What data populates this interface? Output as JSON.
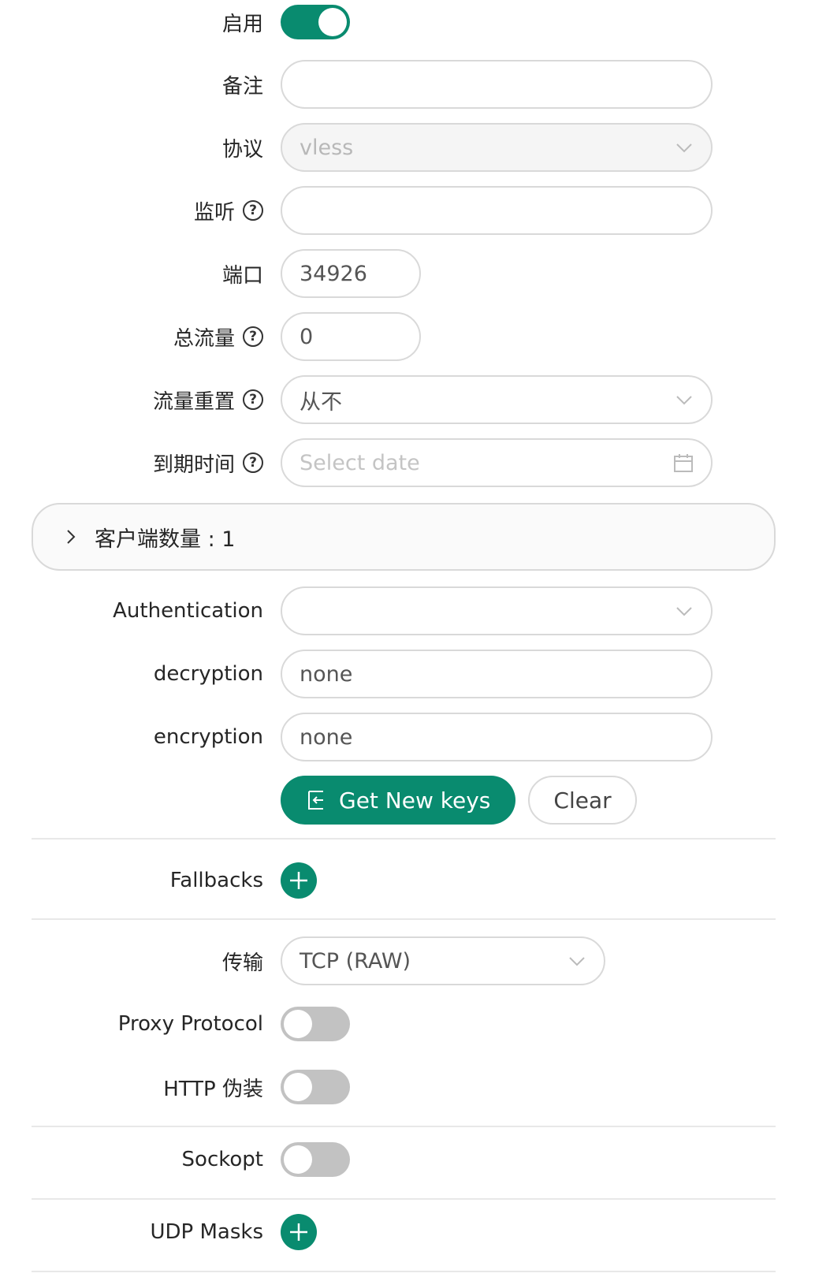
{
  "form": {
    "enable": {
      "label": "启用",
      "value": true
    },
    "remark": {
      "label": "备注",
      "value": ""
    },
    "protocol": {
      "label": "协议",
      "value": "vless"
    },
    "listen": {
      "label": "监听",
      "value": ""
    },
    "port": {
      "label": "端口",
      "value": "34926"
    },
    "total_traffic": {
      "label": "总流量",
      "value": "0"
    },
    "traffic_reset": {
      "label": "流量重置",
      "value": "从不"
    },
    "expiry": {
      "label": "到期时间",
      "placeholder": "Select date"
    },
    "clients": {
      "title": "客户端数量 : 1"
    },
    "authentication": {
      "label": "Authentication",
      "value": ""
    },
    "decryption": {
      "label": "decryption",
      "value": "none"
    },
    "encryption": {
      "label": "encryption",
      "value": "none"
    },
    "get_keys_button": "Get New keys",
    "clear_button": "Clear",
    "fallbacks": {
      "label": "Fallbacks"
    },
    "transport": {
      "label": "传输",
      "value": "TCP (RAW)"
    },
    "proxy_protocol": {
      "label": "Proxy Protocol",
      "value": false
    },
    "http_camouflage": {
      "label": "HTTP 伪装",
      "value": false
    },
    "sockopt": {
      "label": "Sockopt",
      "value": false
    },
    "udp_masks": {
      "label": "UDP Masks"
    }
  },
  "colors": {
    "primary": "#098b6f",
    "switch_off": "#c2c2c2",
    "border": "#d9d9d9"
  }
}
